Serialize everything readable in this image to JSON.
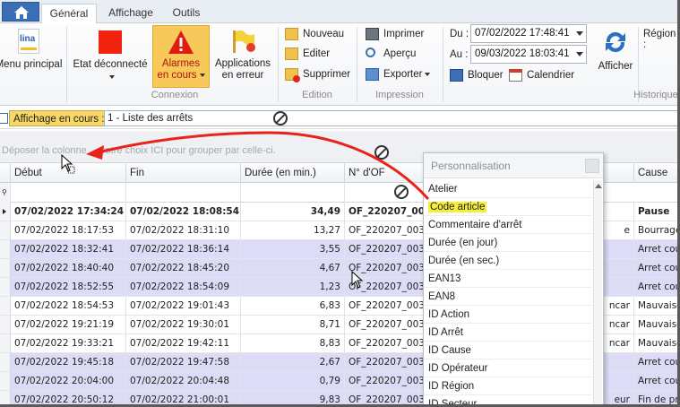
{
  "tabs": [
    "Général",
    "Affichage",
    "Outils"
  ],
  "ribbon": {
    "menu_principal": "Menu principal",
    "logo_text": "lina",
    "etat_deconnecte": "Etat déconnecté",
    "alarmes_line1": "Alarmes",
    "alarmes_line2": "en cours",
    "applications_line1": "Applications",
    "applications_line2": "en erreur",
    "group_connexion": "Connexion",
    "nouveau": "Nouveau",
    "editer": "Editer",
    "supprimer": "Supprimer",
    "group_edition": "Edition",
    "imprimer": "Imprimer",
    "apercu": "Aperçu",
    "exporter": "Exporter",
    "group_impression": "Impression",
    "du_label": "Du :",
    "du_value": "07/02/2022 17:48:41",
    "au_label": "Au :",
    "au_value": "09/03/2022 18:03:41",
    "bloquer": "Bloquer",
    "calendrier": "Calendrier",
    "afficher": "Afficher",
    "region_label": "Région :",
    "group_historique": "Historique"
  },
  "view": {
    "label": "Affichage en cours :",
    "value": "1 - Liste des arrêts"
  },
  "group_hint": "Déposer la colonne ... votre choix ICI pour grouper par celle-ci.",
  "grid": {
    "columns": [
      "Début",
      "Fin",
      "Durée (en min.)",
      "N° d'OF",
      "Cause"
    ],
    "rows": [
      {
        "debut": "07/02/2022 17:34:24",
        "fin": "07/02/2022 18:08:54",
        "duree": "34,49",
        "of": "OF_220207_00",
        "mid": "",
        "cause": "Pause",
        "bold": true,
        "alt": false
      },
      {
        "debut": "07/02/2022 18:17:53",
        "fin": "07/02/2022 18:31:10",
        "duree": "13,27",
        "of": "OF_220207_003",
        "mid": "e",
        "cause": "Bourrage",
        "bold": false,
        "alt": false
      },
      {
        "debut": "07/02/2022 18:32:41",
        "fin": "07/02/2022 18:36:14",
        "duree": "3,55",
        "of": "OF_220207_003",
        "mid": "",
        "cause": "Arret cour",
        "bold": false,
        "alt": true
      },
      {
        "debut": "07/02/2022 18:40:40",
        "fin": "07/02/2022 18:45:20",
        "duree": "4,67",
        "of": "OF_220207_003",
        "mid": "",
        "cause": "Arret cour",
        "bold": false,
        "alt": true
      },
      {
        "debut": "07/02/2022 18:52:55",
        "fin": "07/02/2022 18:54:09",
        "duree": "1,23",
        "of": "OF_220207_003",
        "mid": "",
        "cause": "Arret cour",
        "bold": false,
        "alt": true
      },
      {
        "debut": "07/02/2022 18:54:53",
        "fin": "07/02/2022 19:01:43",
        "duree": "6,83",
        "of": "OF_220207_003",
        "mid": "ncar",
        "cause": "Mauvaise",
        "bold": false,
        "alt": false
      },
      {
        "debut": "07/02/2022 19:21:19",
        "fin": "07/02/2022 19:30:01",
        "duree": "8,71",
        "of": "OF_220207_003",
        "mid": "ncar",
        "cause": "Mauvaise",
        "bold": false,
        "alt": false
      },
      {
        "debut": "07/02/2022 19:33:21",
        "fin": "07/02/2022 19:42:11",
        "duree": "8,83",
        "of": "OF_220207_003",
        "mid": "ncar",
        "cause": "Mauvaise",
        "bold": false,
        "alt": false
      },
      {
        "debut": "07/02/2022 19:45:18",
        "fin": "07/02/2022 19:47:58",
        "duree": "2,67",
        "of": "OF_220207_003",
        "mid": "",
        "cause": "Arret cour",
        "bold": false,
        "alt": true
      },
      {
        "debut": "07/02/2022 20:04:00",
        "fin": "07/02/2022 20:04:48",
        "duree": "0,79",
        "of": "OF_220207_003",
        "mid": "",
        "cause": "Arret cour",
        "bold": false,
        "alt": true
      },
      {
        "debut": "07/02/2022 20:50:12",
        "fin": "07/02/2022 21:00:01",
        "duree": "9,83",
        "of": "OF_220207_003",
        "mid": "eur",
        "cause": "Fin de pro",
        "bold": false,
        "alt": true
      }
    ]
  },
  "popup": {
    "title": "Personnalisation",
    "items": [
      "Atelier",
      "Code article",
      "Commentaire d'arrêt",
      "Durée (en jour)",
      "Durée (en sec.)",
      "EAN13",
      "EAN8",
      "ID Action",
      "ID Arrêt",
      "ID Cause",
      "ID Opérateur",
      "ID Région",
      "ID Secteur"
    ],
    "highlighted_index": 1
  },
  "colors": {
    "accent_red": "#e8231a",
    "alarm_bg": "#f5c85a",
    "row_alt": "#dcdcf6",
    "highlight": "#f7f03a"
  }
}
